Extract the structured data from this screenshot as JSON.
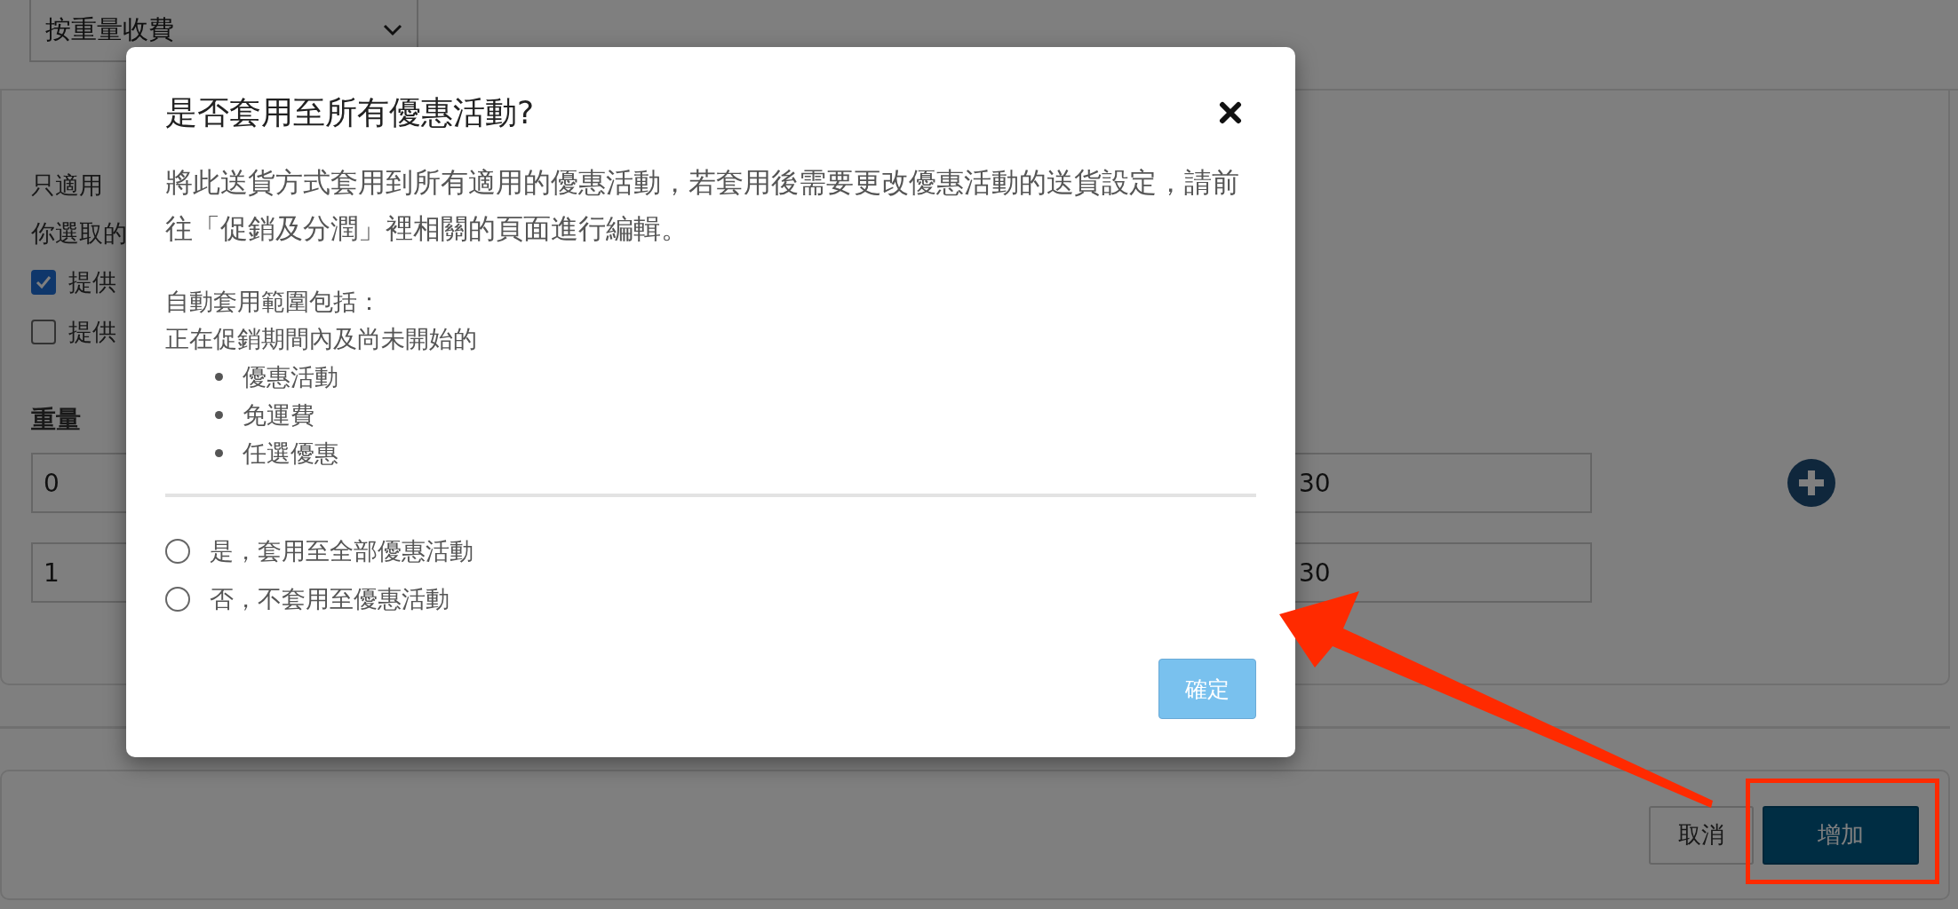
{
  "background": {
    "dropdown": {
      "value": "按重量收費"
    },
    "texts": [
      "只適用",
      "你選取的"
    ],
    "checkboxes": [
      {
        "label": "提供",
        "checked": true
      },
      {
        "label": "提供",
        "checked": false
      }
    ],
    "weight_label": "重量",
    "rows": [
      {
        "weight": "0",
        "price": "30"
      },
      {
        "weight": "1",
        "price": "30"
      }
    ],
    "buttons": [
      {
        "label": "取消",
        "kind": "secondary"
      },
      {
        "label": "增加",
        "kind": "primary"
      }
    ]
  },
  "dialog": {
    "title": "是否套用至所有優惠活動?",
    "description": "將此送貨方式套用到所有適用的優惠活動，若套用後需要更改優惠活動的送貨設定，請前往「促銷及分潤」裡相關的頁面進行編輯。",
    "scope_heading": "自動套用範圍包括：",
    "scope_intro": "正在促銷期間內及尚未開始的",
    "scope_items": [
      "優惠活動",
      "免運費",
      "任選優惠"
    ],
    "options": [
      {
        "label": "是，套用至全部優惠活動",
        "selected": false
      },
      {
        "label": "否，不套用至優惠活動",
        "selected": false
      }
    ],
    "confirm_button": {
      "label": "確定",
      "disabled": true
    }
  }
}
